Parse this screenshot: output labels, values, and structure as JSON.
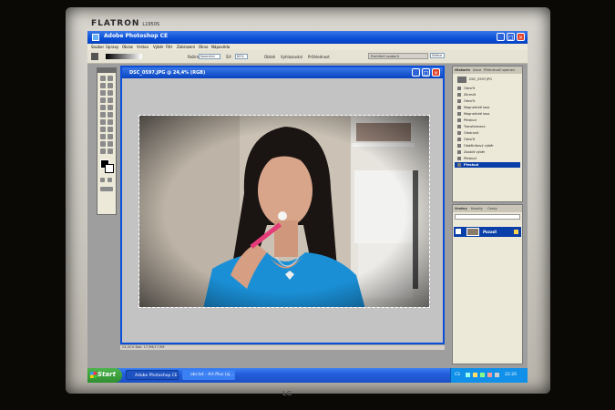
{
  "monitor": {
    "brand": "FLATRON",
    "model": "L1950S",
    "base_logo": "LG"
  },
  "app": {
    "title": "Adobe Photoshop CE",
    "menus": [
      "Soubor",
      "Úpravy",
      "Obraz",
      "Vrstva",
      "Výběr",
      "Filtr",
      "Zobrazení",
      "Okno",
      "Nápověda"
    ],
    "options": {
      "mode_label": "Režim:",
      "mode_value": "Normální",
      "width_label": "Šíř:",
      "width_value": "80%",
      "checks": [
        "Obtah",
        "Vyhlazování",
        "Průhlednost"
      ],
      "tab_text": "Prohlížeč souborů",
      "tab2": "Štětce"
    }
  },
  "document": {
    "title": "DSC_0597.JPG @ 24,4% (RGB)",
    "status": "24,41%  Dok: 17,9M/17,9M"
  },
  "history": {
    "tabs": [
      "Historie",
      "Akce",
      "Přehrávač operací"
    ],
    "snapshot": "DSC_0597.JPG",
    "items": [
      "Otevřít",
      "Zkreslit",
      "Otevřít",
      "Magnetické laso",
      "Magnetické laso",
      "Přeskud",
      "Transformace",
      "Odstranit",
      "Otevřít",
      "Obdélníkový výběr",
      "Zaoblit výběr",
      "Přeskud",
      "Přeskud"
    ],
    "selected_index": 12
  },
  "layers": {
    "tabs": [
      "Vrstvy",
      "Kanály",
      "Cesty"
    ],
    "layer_name": "Pozadí"
  },
  "taskbar": {
    "start": "Start",
    "tasks": [
      "Adobe Photoshop CE",
      "obr.txt - Art.Plus (zj..."
    ],
    "time": "22:20",
    "lang": "CS"
  }
}
